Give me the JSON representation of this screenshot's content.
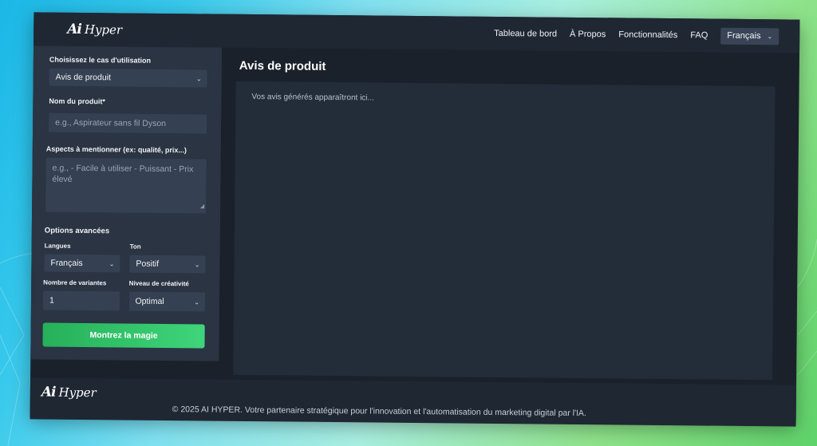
{
  "header": {
    "logo_mark": "Ai",
    "logo_text": "Hyper",
    "nav": [
      "Tableau de bord",
      "À Propos",
      "Fonctionnalités",
      "FAQ"
    ],
    "language": "Français"
  },
  "sidebar": {
    "use_case_label": "Choisissez le cas d'utilisation",
    "use_case_value": "Avis de produit",
    "product_label": "Nom du produit*",
    "product_placeholder": "e.g., Aspirateur sans fil Dyson",
    "aspects_label": "Aspects à mentionner (ex: qualité, prix...)",
    "aspects_placeholder": "e.g., - Facile à utiliser - Puissant - Prix élevé",
    "advanced_title": "Options avancées",
    "languages_label": "Langues",
    "languages_value": "Français",
    "tone_label": "Ton",
    "tone_value": "Positif",
    "variants_label": "Nombre de variantes",
    "variants_value": "1",
    "creativity_label": "Niveau de créativité",
    "creativity_value": "Optimal",
    "submit_label": "Montrez la magie"
  },
  "main": {
    "title": "Avis de produit",
    "output_placeholder": "Vos avis générés apparaîtront ici..."
  },
  "footer": {
    "logo_mark": "Ai",
    "logo_text": "Hyper",
    "copyright": "© 2025 AI HYPER. Votre partenaire stratégique pour l'innovation et l'automatisation du marketing digital par l'IA."
  },
  "colors": {
    "app_bg": "#1b212b",
    "header_bg": "#1f2733",
    "sidebar_bg": "#2a3442",
    "input_bg": "#354052",
    "accent_green": "#3fd57a"
  }
}
